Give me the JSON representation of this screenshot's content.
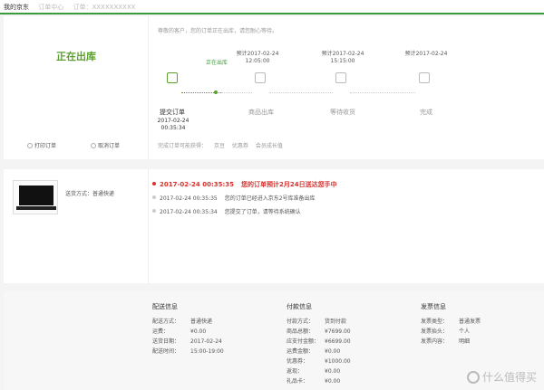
{
  "breadcrumb": {
    "home": "我的京东",
    "mid": "订单中心",
    "tail": "订单：XXXXXXXXXX"
  },
  "status": {
    "title": "正在出库",
    "notice": "尊敬的客户，您的订单正在出库，请您耐心等待。",
    "print_label": "打印订单",
    "cancel_label": "取消订单",
    "active_label": "正在出库"
  },
  "steps": [
    {
      "label": "提交订单",
      "date": "2017-02-24",
      "time": "00:35:34"
    },
    {
      "label": "商品出库",
      "top": "预计2017-02-24",
      "top_time": "12:05:00"
    },
    {
      "label": "等待收货",
      "top": "预计2017-02-24",
      "top_time": "15:15:00"
    },
    {
      "label": "完成",
      "top": "预计2017-02-24",
      "top_time": ""
    }
  ],
  "footer": {
    "prefix": "完成订单可能获得：",
    "jingdou": "京豆",
    "coupon": "优惠券",
    "growth": "会员成长值"
  },
  "tracking": {
    "ship_method": "送货方式：普通快递",
    "events": [
      {
        "time": "2017-02-24 00:35:35",
        "text": "您的订单预计2月24日送达您手中"
      },
      {
        "time": "2017-02-24 00:35:35",
        "text": "您的订单已经进入京东2号库准备出库"
      },
      {
        "time": "2017-02-24 00:35:34",
        "text": "您提交了订单，请等待系统确认"
      }
    ]
  },
  "delivery": {
    "title": "配送信息",
    "rows": [
      {
        "k": "配送方式：",
        "v": "普通快递"
      },
      {
        "k": "运费：",
        "v": "¥0.00"
      },
      {
        "k": "送货日期：",
        "v": "2017-02-24"
      },
      {
        "k": "配送时间：",
        "v": "15:00-19:00"
      }
    ]
  },
  "payment": {
    "title": "付款信息",
    "rows": [
      {
        "k": "付款方式：",
        "v": "货到付款"
      },
      {
        "k": "商品总额：",
        "v": "¥7699.00"
      },
      {
        "k": "应支付金额：",
        "v": "¥6699.00"
      },
      {
        "k": "运费金额：",
        "v": "¥0.00"
      },
      {
        "k": "优惠券：",
        "v": "¥1000.00"
      },
      {
        "k": "返现：",
        "v": "¥0.00"
      },
      {
        "k": "礼品卡：",
        "v": "¥0.00"
      }
    ]
  },
  "invoice": {
    "title": "发票信息",
    "rows": [
      {
        "k": "发票类型：",
        "v": "普通发票"
      },
      {
        "k": "发票抬头：",
        "v": "个人"
      },
      {
        "k": "发票内容：",
        "v": "明细"
      }
    ]
  },
  "watermark": "什么值得买",
  "colors": {
    "accent": "#5aa02c",
    "alert": "#d8312d"
  }
}
